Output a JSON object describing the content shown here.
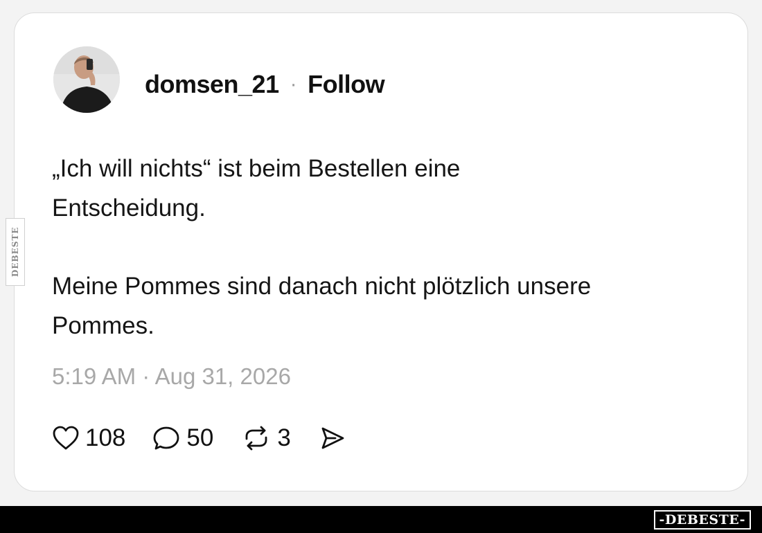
{
  "post": {
    "username": "domsen_21",
    "separator": "·",
    "follow_label": "Follow",
    "paragraph_1_line_1": "„Ich will nichts“ ist beim Bestellen eine",
    "paragraph_1_line_2": "Entscheidung.",
    "paragraph_2_line_1": "Meine Pommes sind danach nicht plötzlich unsere",
    "paragraph_2_line_2": "Pommes.",
    "timestamp": "5:19 AM · Aug 31, 2026"
  },
  "actions": {
    "likes": "108",
    "replies": "50",
    "reposts": "3",
    "share_icon": "send-icon"
  },
  "watermark": {
    "side": "DEBESTE",
    "footer": "-DEBESTE-"
  },
  "colors": {
    "text": "#151515",
    "muted": "#a8a8a8",
    "footer_bg": "#000000"
  }
}
